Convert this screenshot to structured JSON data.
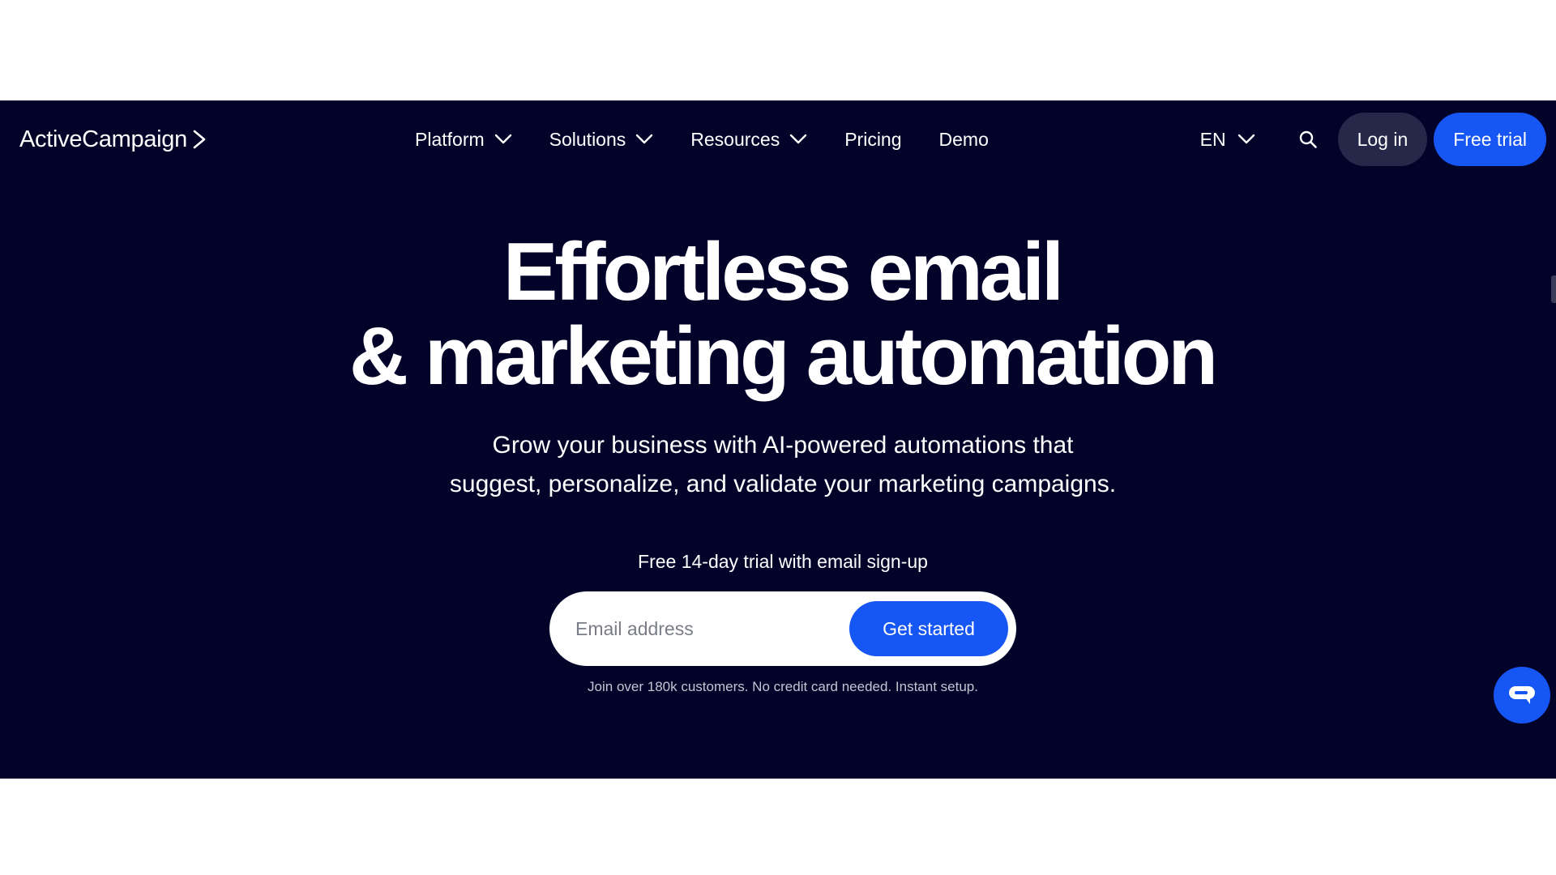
{
  "nav": {
    "logo": "ActiveCampaign",
    "items": [
      {
        "label": "Platform",
        "has_dropdown": true
      },
      {
        "label": "Solutions",
        "has_dropdown": true
      },
      {
        "label": "Resources",
        "has_dropdown": true
      },
      {
        "label": "Pricing",
        "has_dropdown": false
      },
      {
        "label": "Demo",
        "has_dropdown": false
      }
    ],
    "language": "EN",
    "login_label": "Log in",
    "trial_label": "Free trial"
  },
  "hero": {
    "headline_line1": "Effortless email",
    "headline_line2": "& marketing automation",
    "subtext_line1": "Grow your business with AI-powered automations that",
    "subtext_line2": "suggest, personalize, and validate your marketing campaigns.",
    "trial_note": "Free 14-day trial with email sign-up",
    "email_placeholder": "Email address",
    "cta_label": "Get started",
    "fine_print": "Join over 180k customers. No credit card needed. Instant setup."
  },
  "icons": {
    "logo_chevron": "chevron-right-icon",
    "dropdown": "chevron-down-icon",
    "search": "search-icon",
    "chat": "chat-bubble-icon"
  },
  "colors": {
    "hero_bg": "#03032a",
    "accent_blue": "#1656f4",
    "login_bg": "#26284a"
  }
}
